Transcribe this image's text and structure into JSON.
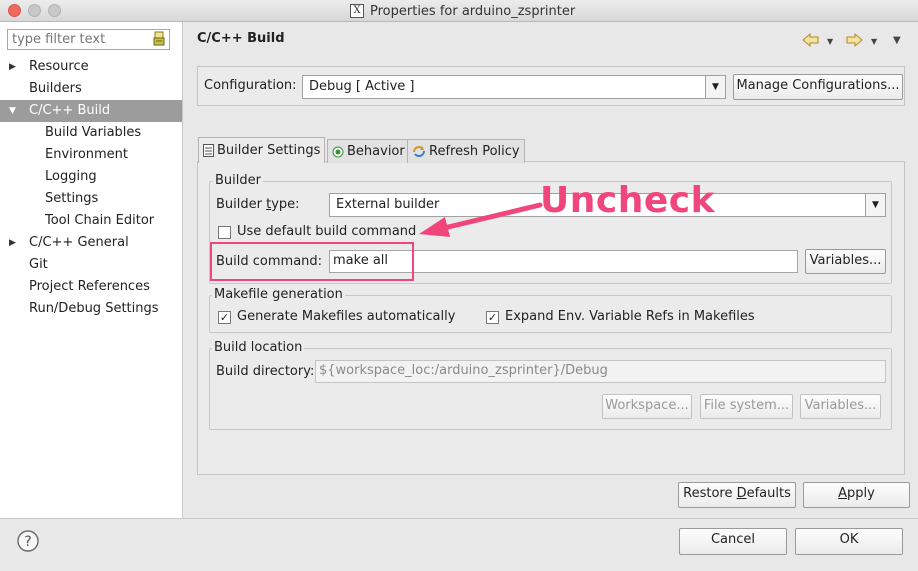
{
  "window": {
    "title": "Properties for arduino_zsprinter"
  },
  "filter": {
    "placeholder": "type filter text"
  },
  "tree": [
    {
      "label": "Resource",
      "expandable": true
    },
    {
      "label": "Builders"
    },
    {
      "label": "C/C++ Build",
      "expanded": true,
      "selected": true
    },
    {
      "label": "Build Variables"
    },
    {
      "label": "Environment"
    },
    {
      "label": "Logging"
    },
    {
      "label": "Settings"
    },
    {
      "label": "Tool Chain Editor"
    },
    {
      "label": "C/C++ General",
      "expandable": true
    },
    {
      "label": "Git"
    },
    {
      "label": "Project References"
    },
    {
      "label": "Run/Debug Settings"
    }
  ],
  "page": {
    "title": "C/C++ Build"
  },
  "config": {
    "label": "Configuration:",
    "value": "Debug  [ Active ]",
    "manage_button": "Manage Configurations..."
  },
  "tabs": [
    {
      "label": "Builder Settings",
      "icon": "document-icon",
      "active": true
    },
    {
      "label": "Behavior",
      "icon": "radio-icon"
    },
    {
      "label": "Refresh Policy",
      "icon": "refresh-icon"
    }
  ],
  "builder": {
    "group_label": "Builder",
    "type_label": "Builder type:",
    "type_value": "External builder",
    "use_default_label": "Use default build command",
    "use_default_checked": false,
    "command_label": "Build command:",
    "command_value": "make all",
    "variables_button": "Variables..."
  },
  "makefile": {
    "group_label": "Makefile generation",
    "generate_label": "Generate Makefiles automatically",
    "generate_checked": true,
    "expand_label": "Expand Env. Variable Refs in Makefiles",
    "expand_checked": true
  },
  "location": {
    "group_label": "Build location",
    "dir_label": "Build directory:",
    "dir_value": "${workspace_loc:/arduino_zsprinter}/Debug",
    "workspace_button": "Workspace...",
    "filesystem_button": "File system...",
    "variables_button": "Variables..."
  },
  "annotation": {
    "text": "Uncheck",
    "color": "#f0467c"
  },
  "footer": {
    "restore_button": "Restore Defaults",
    "apply_button": "Apply",
    "cancel_button": "Cancel",
    "ok_button": "OK",
    "help_icon": "help-icon"
  },
  "colors": {
    "accent": "#f0467c",
    "selection": "#9c9c9c",
    "traffic_close": "#ee6a5f"
  }
}
